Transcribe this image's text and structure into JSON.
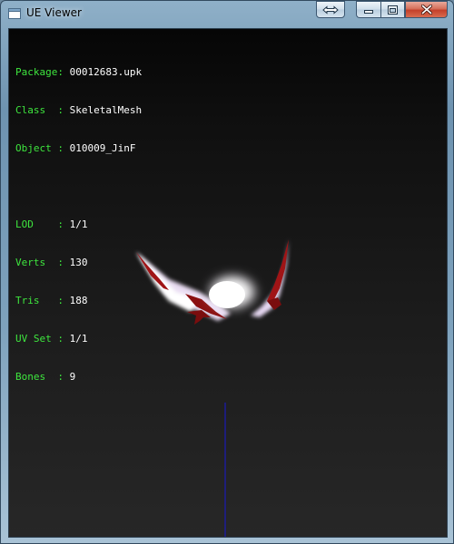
{
  "window": {
    "title": "UE Viewer",
    "icon": "app-window-icon",
    "controls": [
      "resize-icon",
      "minimize-icon",
      "maximize-icon",
      "close-icon"
    ]
  },
  "info": {
    "package_key": "Package: ",
    "package_value": "00012683.upk",
    "class_key": "Class  : ",
    "class_value": "SkeletalMesh",
    "object_key": "Object : ",
    "object_value": "010009_JinF",
    "lod_key": "LOD    : ",
    "lod_value": "1/1",
    "verts_key": "Verts  : ",
    "verts_value": "130",
    "tris_key": "Tris   : ",
    "tris_value": "188",
    "uvset_key": "UV Set : ",
    "uvset_value": "1/1",
    "bones_key": "Bones  : ",
    "bones_value": "9"
  },
  "colors": {
    "label": "#3ee63e",
    "value": "#ffffff",
    "axis": "#1a1ab4",
    "mesh_glow": "#ffffff",
    "mesh_dark": "#8a0f10"
  }
}
